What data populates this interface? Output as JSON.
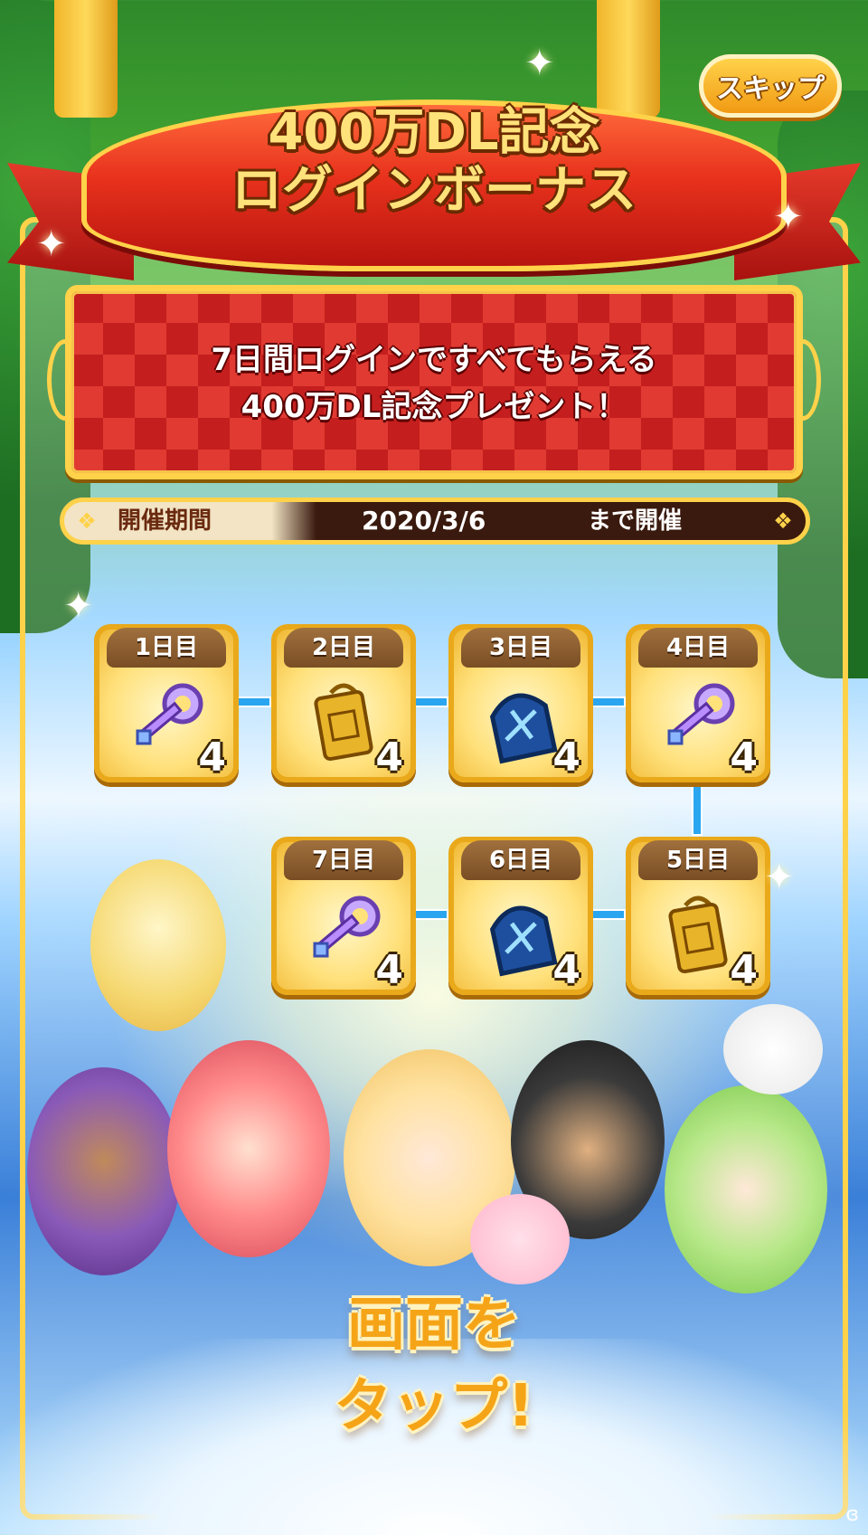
{
  "skip_button": {
    "label": "スキップ"
  },
  "banner": {
    "title_line1": "400万DL記念",
    "title_line2": "ログインボーナス"
  },
  "message": {
    "line1": "7日間ログインですべてもらえる",
    "line2": "400万DL記念プレゼント！"
  },
  "period": {
    "label": "開催期間",
    "date": "2020/3/6",
    "until": "まで開催"
  },
  "days": [
    {
      "label": "1日目",
      "item_icon": "key-icon",
      "count": "4"
    },
    {
      "label": "2日目",
      "item_icon": "gold-tag-icon",
      "count": "4"
    },
    {
      "label": "3日目",
      "item_icon": "blue-scroll-icon",
      "count": "4"
    },
    {
      "label": "4日目",
      "item_icon": "key-icon",
      "count": "4"
    },
    {
      "label": "5日目",
      "item_icon": "gold-tag-icon",
      "count": "4"
    },
    {
      "label": "6日目",
      "item_icon": "blue-scroll-icon",
      "count": "4"
    },
    {
      "label": "7日目",
      "item_icon": "key-icon",
      "count": "4"
    }
  ],
  "tap_prompt": {
    "line1": "画面を",
    "line2": "タップ!"
  },
  "colors": {
    "accent_gold": "#ffd24a",
    "banner_red": "#e8321d",
    "tap_orange": "#f5a418",
    "connector_blue": "#2aa6f0"
  }
}
